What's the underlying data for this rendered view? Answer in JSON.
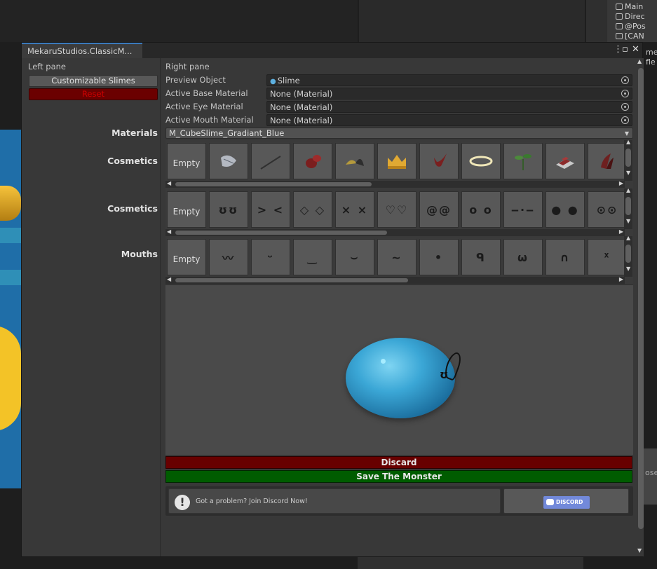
{
  "window": {
    "tab_title": "MekaruStudios.ClassicM...",
    "menu_icon": "kebab-menu-icon",
    "maximize_icon": "maximize-icon",
    "close_icon": "close-icon"
  },
  "hierarchy": {
    "items": [
      "Main",
      "Direc",
      "@Pos",
      "[CAN"
    ],
    "side_fragments": [
      "me",
      "fle"
    ],
    "bottom_fragment": "ose"
  },
  "left_pane": {
    "header": "Left pane",
    "customizable_button": "Customizable Slimes",
    "reset_button": "Reset"
  },
  "right_pane": {
    "header": "Right pane",
    "properties": [
      {
        "label": "Preview Object",
        "value": "Slime"
      },
      {
        "label": "Active Base Material",
        "value": "None (Material)"
      },
      {
        "label": "Active Eye Material",
        "value": "None (Material)"
      },
      {
        "label": "Active Mouth Material",
        "value": "None (Material)"
      }
    ],
    "materials_label": "Materials",
    "materials_value": "M_CubeSlime_Gradiant_Blue",
    "sections": [
      {
        "label": "Cosmetics",
        "items": [
          "Empty",
          "umbrella-icon",
          "wand-icon",
          "boxing-glove-icon",
          "horns-icon",
          "crown-icon",
          "horn-icon",
          "halo-icon",
          "sprout-icon",
          "hat-box-icon",
          "wings-icon"
        ]
      },
      {
        "label": "Cosmetics",
        "items": [
          "Empty",
          "ʊʊ",
          "> <",
          "◇ ◇",
          "× ×",
          "♡♡",
          "@@",
          "o o",
          "‒·‒",
          "● ●",
          "⊙⊙"
        ]
      },
      {
        "label": "Mouths",
        "items": [
          "Empty",
          "〰",
          "ᵕ",
          "‿",
          "⌣",
          "~",
          "•",
          "ᑫ",
          "ω",
          "∩",
          "ᕁ"
        ]
      }
    ],
    "discard_button": "Discard",
    "save_button": "Save The Monster",
    "help_text": "Got a problem? Join Discord Now!",
    "discord_button": "DISCORD"
  },
  "colors": {
    "reset_bg": "#6b0000",
    "discard_bg": "#680000",
    "save_bg": "#005c00",
    "discord_brand": "#7289da",
    "slime": "#3ba7d6"
  }
}
